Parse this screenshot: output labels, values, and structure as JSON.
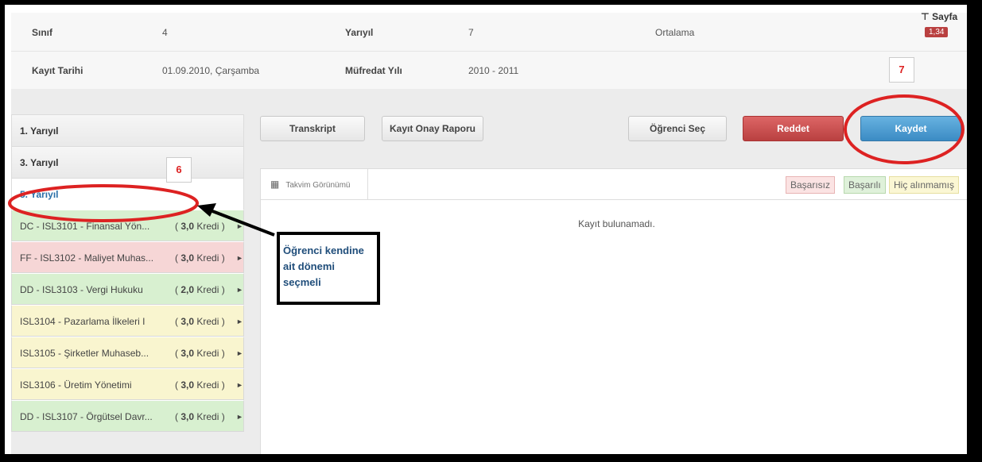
{
  "info": {
    "sinif_label": "Sınıf",
    "sinif_value": "4",
    "yariyil_label": "Yarıyıl",
    "yariyil_value": "7",
    "ortalama_label": "Ortalama",
    "kayit_label": "Kayıt Tarihi",
    "kayit_value": "01.09.2010, Çarşamba",
    "mufredat_label": "Müfredat Yılı",
    "mufredat_value": "2010 - 2011",
    "page_pin": "Sayfa",
    "ortalama_value": "1,34"
  },
  "sidebar": {
    "headers": [
      "1. Yarıyıl",
      "3. Yarıyıl",
      "5. Yarıyıl"
    ],
    "courses": [
      {
        "name": "DC - ISL3101 - Finansal Yön...",
        "credit": "3,0",
        "status": "green"
      },
      {
        "name": "FF - ISL3102 - Maliyet Muhas...",
        "credit": "3,0",
        "status": "red"
      },
      {
        "name": "DD - ISL3103 - Vergi Hukuku",
        "credit": "2,0",
        "status": "green"
      },
      {
        "name": "ISL3104 - Pazarlama İlkeleri I",
        "credit": "3,0",
        "status": "yellow"
      },
      {
        "name": "ISL3105 - Şirketler Muhaseb...",
        "credit": "3,0",
        "status": "yellow"
      },
      {
        "name": "ISL3106 - Üretim Yönetimi",
        "credit": "3,0",
        "status": "yellow"
      },
      {
        "name": "DD - ISL3107 - Örgütsel Davr...",
        "credit": "3,0",
        "status": "green"
      }
    ],
    "credit_prefix": "(",
    "credit_suffix": "Kredi )"
  },
  "toolbar": {
    "transkript": "Transkript",
    "kayit_onay": "Kayıt Onay Raporu",
    "ogrenci_sec": "Öğrenci Seç",
    "reddet": "Reddet",
    "kaydet": "Kaydet"
  },
  "panel": {
    "calendar_view": "Takvim Görünümü",
    "legend": [
      "Başarısız",
      "Başarılı",
      "Hiç alınmamış"
    ],
    "empty": "Kayıt bulunamadı."
  },
  "annotations": {
    "step6": "6",
    "step7": "7",
    "callout": "Öğrenci kendine ait dönemi seçmeli"
  },
  "colors": {
    "accent": "#3b8bc4",
    "danger": "#b94040",
    "annotation": "#d22",
    "success": "#d8f0d0",
    "fail": "#f6d6d6",
    "unknown": "#f9f5cf"
  }
}
